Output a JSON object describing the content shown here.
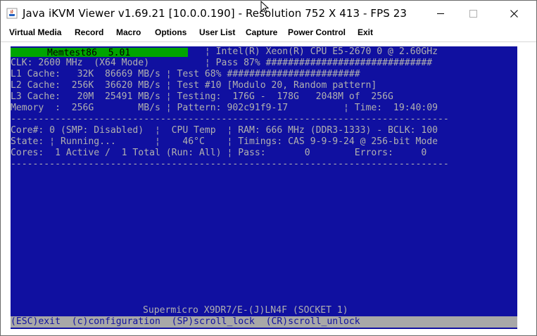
{
  "window": {
    "title": "Java iKVM Viewer v1.69.21 [10.0.0.190]  - Resolution 752 X 413 - FPS 23",
    "minimize": "–",
    "maximize": "☐",
    "close": "✕"
  },
  "menu": [
    "Virtual Media",
    "Record",
    "Macro",
    "Options",
    "User List",
    "Capture",
    "Power Control",
    "Exit"
  ],
  "screen": {
    "title": "Memtest86  5.01",
    "lines": [
      "                                   ¦ Intel(R) Xeon(R) CPU E5-2670 0 @ 2.60GHz",
      "CLK: 2600 MHz  (X64 Mode)          ¦ Pass 87% ##############################",
      "L1 Cache:   32K  86669 MB/s ¦ Test 68% ########################",
      "L2 Cache:  256K  36620 MB/s ¦ Test #10 [Modulo 20, Random pattern]",
      "L3 Cache:   20M  25491 MB/s ¦ Testing:  176G -  178G   2048M of  256G",
      "Memory  :  256G        MB/s ¦ Pattern: 902c91f9-17          ¦ Time:  19:40:09",
      "-------------------------------------------------------------------------------",
      "Core#: 0 (SMP: Disabled)  ¦  CPU Temp  ¦ RAM: 666 MHz (DDR3-1333) - BCLK: 100",
      "State: ¦ Running...       ¦    46°C    ¦ Timings: CAS 9-9-9-24 @ 256-bit Mode",
      "Cores:  1 Active /  1 Total (Run: All) ¦ Pass:       0        Errors:     0",
      "-------------------------------------------------------------------------------"
    ],
    "board": "Supermicro X9DR7/E-(J)LN4F (SOCKET 1)",
    "footer": "(ESC)exit  (c)configuration  (SP)scroll_lock  (CR)scroll_unlock"
  },
  "colors": {
    "screen_bg": "#1010a0",
    "text": "#b0b0b0",
    "title_bar": "#00a400",
    "footer_bar": "#a8a8a8"
  },
  "icons": {
    "app": "java-cup-icon",
    "pointer": "mouse-cursor-icon"
  }
}
